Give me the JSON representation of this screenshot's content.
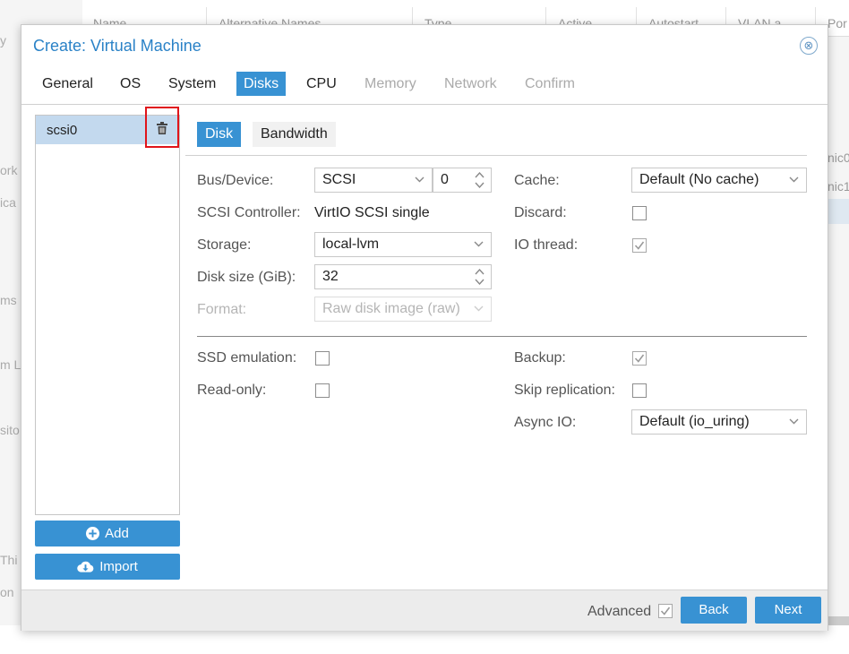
{
  "background": {
    "columns": [
      "Name",
      "Alternative Names",
      "Type",
      "Active",
      "Autostart",
      "VLAN a...",
      "Por"
    ],
    "side_texts": [
      "y",
      "ork",
      "ica",
      "ms",
      "m L",
      "sito",
      "Thi",
      "on"
    ],
    "right_texts": [
      "nic0",
      "nic1"
    ]
  },
  "dialog": {
    "title": "Create: Virtual Machine",
    "close_glyph": "⊗",
    "tabs": [
      {
        "label": "General",
        "state": "normal"
      },
      {
        "label": "OS",
        "state": "normal"
      },
      {
        "label": "System",
        "state": "normal"
      },
      {
        "label": "Disks",
        "state": "active"
      },
      {
        "label": "CPU",
        "state": "normal"
      },
      {
        "label": "Memory",
        "state": "disabled"
      },
      {
        "label": "Network",
        "state": "disabled"
      },
      {
        "label": "Confirm",
        "state": "disabled"
      }
    ]
  },
  "disk_list": {
    "items": [
      "scsi0"
    ],
    "add_label": "Add",
    "import_label": "Import"
  },
  "disk_tabs": {
    "disk": "Disk",
    "bandwidth": "Bandwidth"
  },
  "form": {
    "bus_device": {
      "label": "Bus/Device:",
      "bus": "SCSI",
      "device": "0"
    },
    "scsi_controller": {
      "label": "SCSI Controller:",
      "value": "VirtIO SCSI single"
    },
    "storage": {
      "label": "Storage:",
      "value": "local-lvm"
    },
    "disk_size": {
      "label": "Disk size (GiB):",
      "value": "32"
    },
    "format": {
      "label": "Format:",
      "value": "Raw disk image (raw)"
    },
    "cache": {
      "label": "Cache:",
      "value": "Default (No cache)"
    },
    "discard": {
      "label": "Discard:",
      "checked": false
    },
    "io_thread": {
      "label": "IO thread:",
      "checked": true
    },
    "ssd_emulation": {
      "label": "SSD emulation:",
      "checked": false
    },
    "read_only": {
      "label": "Read-only:",
      "checked": false
    },
    "backup": {
      "label": "Backup:",
      "checked": true
    },
    "skip_replication": {
      "label": "Skip replication:",
      "checked": false
    },
    "async_io": {
      "label": "Async IO:",
      "value": "Default (io_uring)"
    }
  },
  "footer": {
    "advanced_label": "Advanced",
    "advanced_checked": true,
    "back_label": "Back",
    "next_label": "Next"
  },
  "colors": {
    "accent": "#3892d3",
    "title": "#2a82c7",
    "highlight_box": "#e0141a",
    "selected_row": "#c3d9ee"
  }
}
